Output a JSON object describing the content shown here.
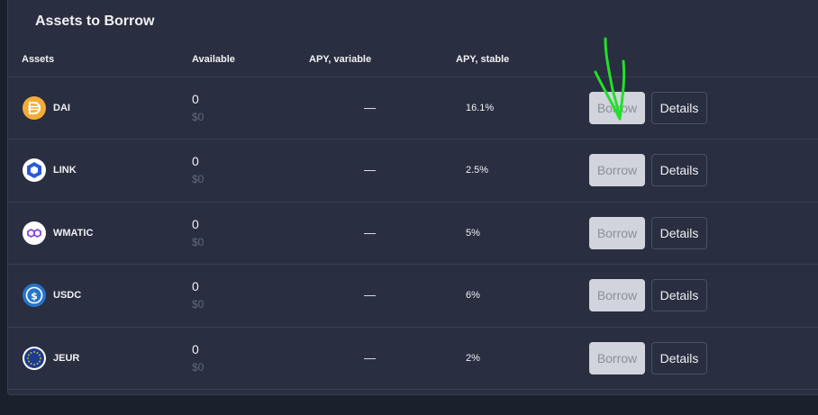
{
  "panel": {
    "title": "Assets to Borrow"
  },
  "columns": {
    "assets": "Assets",
    "available": "Available",
    "apy_variable": "APY, variable",
    "apy_stable": "APY, stable"
  },
  "rows": [
    {
      "asset": "DAI",
      "available": "0",
      "available_usd": "$0",
      "apy_variable": "—",
      "apy_stable": "16.1%",
      "borrow_label": "Borrow",
      "details_label": "Details",
      "icon": "dai-icon",
      "icon_color": "#f5ac37"
    },
    {
      "asset": "LINK",
      "available": "0",
      "available_usd": "$0",
      "apy_variable": "—",
      "apy_stable": "2.5%",
      "borrow_label": "Borrow",
      "details_label": "Details",
      "icon": "chainlink-icon",
      "icon_color": "#2a5ada"
    },
    {
      "asset": "WMATIC",
      "available": "0",
      "available_usd": "$0",
      "apy_variable": "—",
      "apy_stable": "5%",
      "borrow_label": "Borrow",
      "details_label": "Details",
      "icon": "polygon-icon",
      "icon_color": "#8247e5"
    },
    {
      "asset": "USDC",
      "available": "0",
      "available_usd": "$0",
      "apy_variable": "—",
      "apy_stable": "6%",
      "borrow_label": "Borrow",
      "details_label": "Details",
      "icon": "usdc-icon",
      "icon_color": "#2775ca"
    },
    {
      "asset": "JEUR",
      "available": "0",
      "available_usd": "$0",
      "apy_variable": "—",
      "apy_stable": "2%",
      "borrow_label": "Borrow",
      "details_label": "Details",
      "icon": "eu-flag-icon",
      "icon_color": "#1d3c8f"
    }
  ],
  "annotation": {
    "icon": "hand-drawn-arrow-icon",
    "color": "#22e02a"
  }
}
